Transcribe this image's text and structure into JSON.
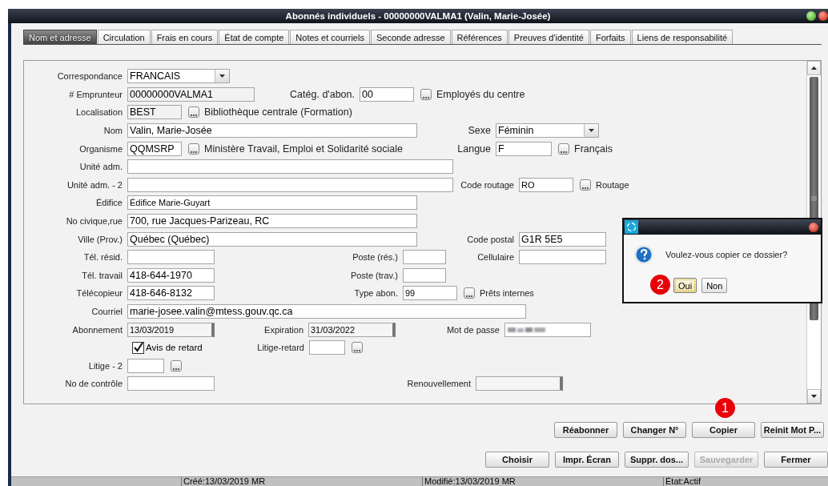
{
  "window": {
    "title": "Abonnés individuels - 00000000VALMA1 (Valin, Marie-Josée)"
  },
  "tabs": [
    {
      "label": "Nom et adresse",
      "selected": true
    },
    {
      "label": "Circulation",
      "selected": false
    },
    {
      "label": "Frais en cours",
      "selected": false
    },
    {
      "label": "État de compte",
      "selected": false
    },
    {
      "label": "Notes et courriels",
      "selected": false
    },
    {
      "label": "Seconde adresse",
      "selected": false
    },
    {
      "label": "Références",
      "selected": false
    },
    {
      "label": "Preuves d'identité",
      "selected": false
    },
    {
      "label": "Forfaits",
      "selected": false
    },
    {
      "label": "Liens de responsabilité",
      "selected": false
    }
  ],
  "form": {
    "rows": [
      [
        {
          "label": "Correspondance",
          "kind": "select",
          "value": "FRANCAIS"
        }
      ],
      [
        {
          "label": "# Emprunteur",
          "kind": "readonly",
          "value": "00000000VALMA1"
        },
        {
          "label": "Catég. d'abon.",
          "kind": "lookup",
          "value": "00",
          "description": "Employés du centre"
        }
      ],
      [
        {
          "label": "Localisation",
          "kind": "lookup",
          "value": "BEST",
          "description": "Bibliothèque centrale (Formation)"
        }
      ],
      [
        {
          "label": "Nom",
          "kind": "text",
          "value": "Valin, Marie-Josée"
        },
        {
          "label": "Sexe",
          "kind": "select",
          "value": "Féminin"
        }
      ],
      [
        {
          "label": "Organisme",
          "kind": "lookup",
          "value": "QQMSRP",
          "description": "Ministère Travail, Emploi et Solidarité sociale"
        },
        {
          "label": "Langue",
          "kind": "lookup",
          "value": "F",
          "description": "Français"
        }
      ],
      [
        {
          "label": "Unité adm.",
          "kind": "text"
        }
      ],
      [
        {
          "label": "Unité adm. - 2",
          "kind": "text"
        },
        {
          "label": "Code routage",
          "kind": "lookup",
          "value": "RO",
          "description": "Routage"
        }
      ],
      [
        {
          "label": "Édifice",
          "kind": "text",
          "value": "Édifice Marie-Guyart"
        }
      ],
      [
        {
          "label": "No civique,rue",
          "kind": "text",
          "value": "700, rue Jacques-Parizeau, RC"
        }
      ],
      [
        {
          "label": "Ville (Prov.)",
          "kind": "text",
          "value": "Québec (Québec)"
        },
        {
          "label": "Code postal",
          "kind": "text",
          "value": "G1R 5E5"
        }
      ],
      [
        {
          "label": "Tél. résid.",
          "kind": "text"
        },
        {
          "label": "Poste (rés.)",
          "kind": "text"
        },
        {
          "label": "Cellulaire",
          "kind": "text"
        }
      ],
      [
        {
          "label": "Tél. travail",
          "kind": "text",
          "value": "418-644-1970"
        },
        {
          "label": "Poste (trav.)",
          "kind": "text"
        }
      ],
      [
        {
          "label": "Télécopieur",
          "kind": "text",
          "value": "418-646-8132"
        },
        {
          "label": "Type abon.",
          "kind": "lookup",
          "value": "99",
          "description": "Prêts internes"
        }
      ],
      [
        {
          "label": "Courriel",
          "kind": "text",
          "value": "marie-josee.valin@mtess.gouv.qc.ca"
        }
      ],
      [
        {
          "label": "Abonnement",
          "kind": "date",
          "value": "13/03/2019"
        },
        {
          "label": "Expiration",
          "kind": "date",
          "value": "31/03/2022"
        },
        {
          "label": "Mot de passe",
          "kind": "password"
        }
      ],
      [
        {
          "label": "Avis de retard",
          "kind": "checkbox",
          "checked": true
        },
        {
          "label": "Litige-retard",
          "kind": "lookup"
        }
      ],
      [
        {
          "label": "Litige - 2",
          "kind": "lookup"
        }
      ],
      [
        {
          "label": "No de contrôle",
          "kind": "text"
        },
        {
          "label": "Renouvellement",
          "kind": "date"
        }
      ]
    ]
  },
  "dialog": {
    "message": "Voulez-vous copier ce dossier?",
    "buttons": [
      {
        "label": "Oui",
        "focused": true,
        "callout": "2"
      },
      {
        "label": "Non",
        "focused": false
      }
    ]
  },
  "buttons_row_1": [
    {
      "label": "Réabonner",
      "disabled": false
    },
    {
      "label": "Changer N°",
      "disabled": false
    },
    {
      "label": "Copier",
      "disabled": false,
      "callout": "1"
    },
    {
      "label": "Reinit Mot P...",
      "disabled": false
    }
  ],
  "buttons_row_2": [
    {
      "label": "Choisir",
      "disabled": false
    },
    {
      "label": "Impr. Écran",
      "disabled": false
    },
    {
      "label": "Suppr. dos...",
      "disabled": false
    },
    {
      "label": "Sauvegarder",
      "disabled": true
    },
    {
      "label": "Fermer",
      "disabled": false
    }
  ],
  "status_bar": [
    "Créé:13/03/2019 MR",
    "Modifié:13/03/2019 MR",
    "État:Actif"
  ]
}
